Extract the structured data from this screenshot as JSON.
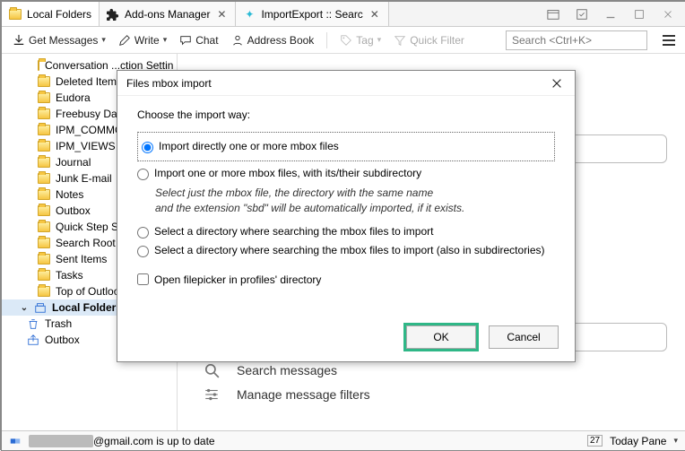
{
  "tabs": [
    {
      "label": "Local Folders",
      "icon": "folder"
    },
    {
      "label": "Add-ons Manager",
      "icon": "puzzle"
    },
    {
      "label": "ImportExport :: Searc",
      "icon": "star"
    }
  ],
  "toolbar": {
    "get_messages": "Get Messages",
    "write": "Write",
    "chat": "Chat",
    "address_book": "Address Book",
    "tag": "Tag",
    "quick_filter": "Quick Filter",
    "search_placeholder": "Search <Ctrl+K>"
  },
  "sidebar": {
    "items": [
      "Conversation ...ction Settin",
      "Deleted Items",
      "Eudora",
      "Freebusy Data",
      "IPM_COMMON",
      "IPM_VIEWS",
      "Journal",
      "Junk E-mail",
      "Notes",
      "Outbox",
      "Quick Step Setti",
      "Search Root",
      "Sent Items",
      "Tasks",
      "Top of Outlook ..."
    ],
    "local_folders": "Local Folders",
    "trash": "Trash",
    "outbox": "Outbox"
  },
  "main": {
    "search_messages": "Search messages",
    "manage_filters": "Manage message filters"
  },
  "dialog": {
    "title": "Files mbox import",
    "heading": "Choose the import way:",
    "opt1": "Import directly one or more mbox files",
    "opt2": "Import one or more mbox files, with its/their subdirectory",
    "opt2_hint1": "Select just the mbox file, the directory with the same name",
    "opt2_hint2": "and the extension \"sbd\" will be automatically imported, if it exists.",
    "opt3": "Select a directory where searching the mbox files to import",
    "opt4": "Select a directory where searching the mbox files to import (also in subdirectories)",
    "check": "Open filepicker in profiles' directory",
    "ok": "OK",
    "cancel": "Cancel"
  },
  "status": {
    "account_suffix": "@gmail.com is up to date",
    "today_pane": "Today Pane",
    "date": "27"
  }
}
